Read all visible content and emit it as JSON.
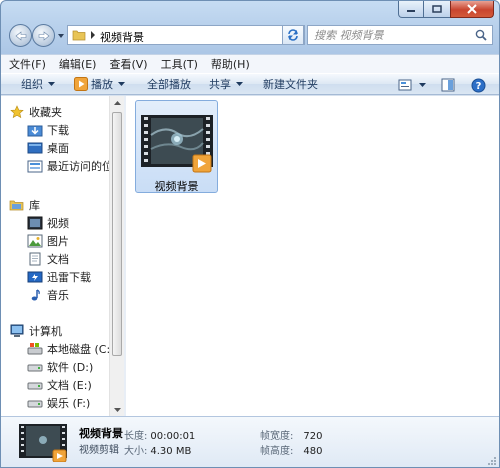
{
  "window": {
    "caption_buttons": {
      "minimize_icon": "minimize-icon",
      "maximize_icon": "maximize-icon",
      "close_icon": "close-icon"
    }
  },
  "address_bar": {
    "path": "视频背景",
    "search_placeholder": "搜索 视频背景"
  },
  "menu": {
    "items": [
      "文件(F)",
      "编辑(E)",
      "查看(V)",
      "工具(T)",
      "帮助(H)"
    ]
  },
  "toolbar": {
    "organize": "组织",
    "play": "播放",
    "play_all": "全部播放",
    "share": "共享",
    "new_folder": "新建文件夹"
  },
  "nav_pane": {
    "favorites_label": "收藏夹",
    "favorites": [
      "下载",
      "桌面",
      "最近访问的位置"
    ],
    "libraries_label": "库",
    "libraries": [
      "视频",
      "图片",
      "文档",
      "迅雷下载",
      "音乐"
    ],
    "computer_label": "计算机",
    "drives": [
      "本地磁盘 (C:)",
      "软件 (D:)",
      "文档 (E:)",
      "娱乐 (F:)"
    ]
  },
  "files": [
    {
      "name": "视频背景",
      "type": "video"
    }
  ],
  "details": {
    "name": "视频背景",
    "type": "视频剪辑",
    "length_label": "长度:",
    "length_value": "00:00:01",
    "size_label": "大小:",
    "size_value": "4.30 MB",
    "width_label": "帧宽度:",
    "width_value": "720",
    "height_label": "帧高度:",
    "height_value": "480"
  },
  "colors": {
    "window_frame": "#b9d1ec",
    "selection": "#c9ddf6",
    "close_button": "#c9452f"
  }
}
